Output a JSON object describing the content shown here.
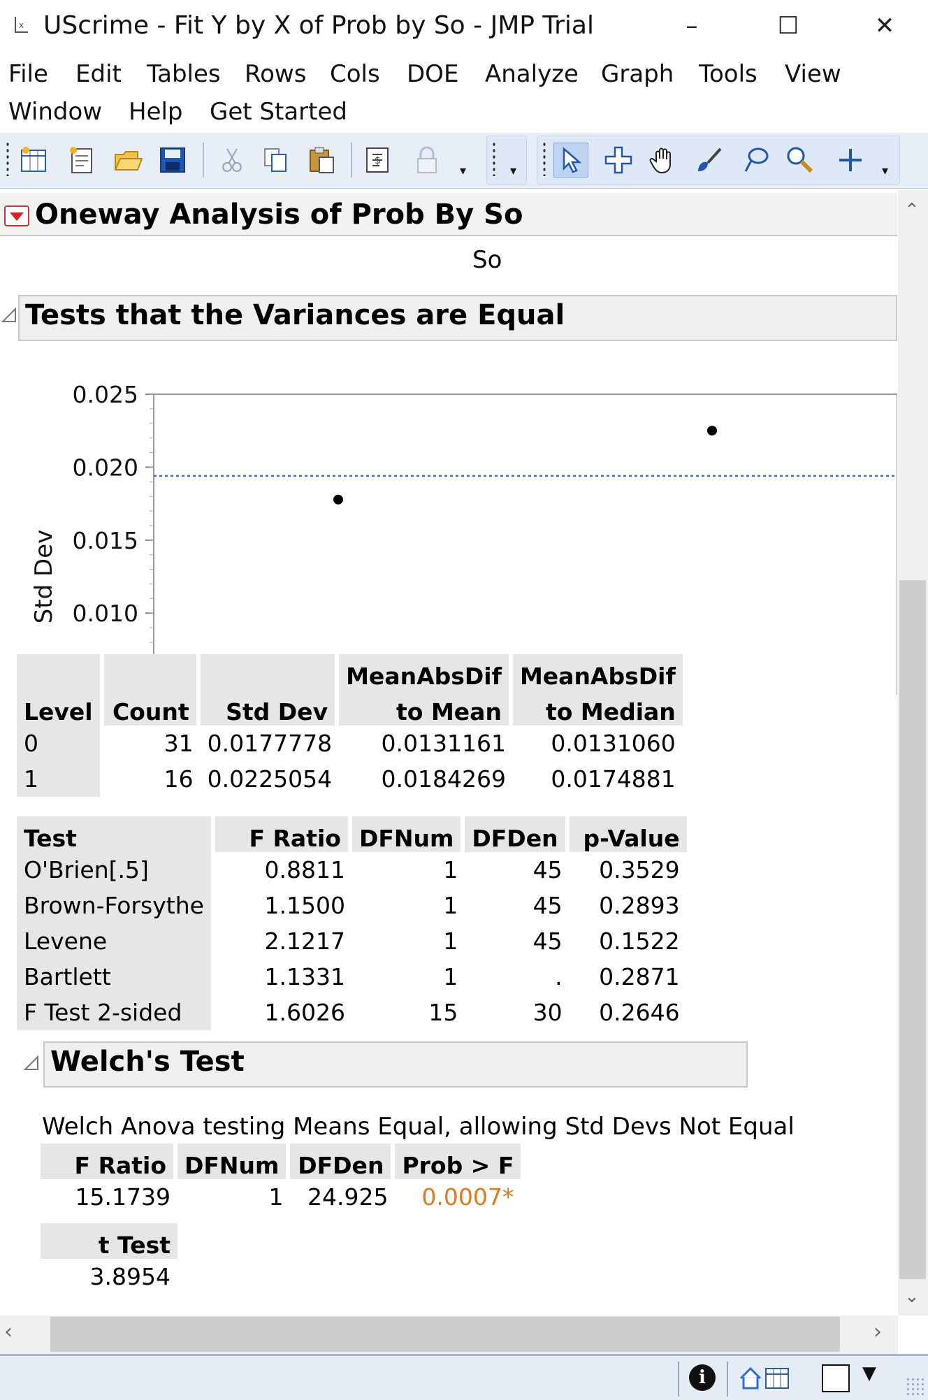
{
  "window": {
    "title": "UScrime - Fit Y by X of Prob by So - JMP Trial",
    "minimize": "–",
    "maximize": "☐",
    "close": "✕"
  },
  "menu": {
    "row1": [
      "File",
      "Edit",
      "Tables",
      "Rows",
      "Cols",
      "DOE",
      "Analyze",
      "Graph",
      "Tools",
      "View"
    ],
    "row2": [
      "Window",
      "Help",
      "Get Started"
    ]
  },
  "report": {
    "title": "Oneway Analysis of Prob By So",
    "top_label": "So",
    "variances_section": "Tests that the Variances are Equal",
    "welch_section": "Welch's Test",
    "welch_caption": "Welch Anova testing Means Equal, allowing Std Devs Not Equal"
  },
  "chart_data": {
    "type": "scatter",
    "ylabel": "Std Dev",
    "xlabel": "So",
    "ylim": [
      0,
      0.025
    ],
    "yticks": [
      "0.025",
      "0.020",
      "0.015",
      "0.010",
      "0.005",
      "0"
    ],
    "xticks": [
      "0",
      "1"
    ],
    "points": [
      {
        "x": 0,
        "y": 0.0177778
      },
      {
        "x": 1,
        "y": 0.0225054
      }
    ],
    "reference_line": {
      "y": 0.0194,
      "style": "dotted",
      "color": "#3a6fd8"
    },
    "grid": false
  },
  "levels_table": {
    "headers": [
      [
        "",
        "Level"
      ],
      [
        "",
        "Count"
      ],
      [
        "",
        "Std Dev"
      ],
      [
        "MeanAbsDif",
        "to Mean"
      ],
      [
        "MeanAbsDif",
        "to Median"
      ]
    ],
    "rows": [
      [
        "0",
        "31",
        "0.0177778",
        "0.0131161",
        "0.0131060"
      ],
      [
        "1",
        "16",
        "0.0225054",
        "0.0184269",
        "0.0174881"
      ]
    ]
  },
  "tests_table": {
    "headers": [
      "Test",
      "F Ratio",
      "DFNum",
      "DFDen",
      "p-Value"
    ],
    "rows": [
      [
        "O'Brien[.5]",
        "0.8811",
        "1",
        "45",
        "0.3529"
      ],
      [
        "Brown-Forsythe",
        "1.1500",
        "1",
        "45",
        "0.2893"
      ],
      [
        "Levene",
        "2.1217",
        "1",
        "45",
        "0.1522"
      ],
      [
        "Bartlett",
        "1.1331",
        "1",
        ".",
        "0.2871"
      ],
      [
        "F Test 2-sided",
        "1.6026",
        "15",
        "30",
        "0.2646"
      ]
    ]
  },
  "welch_table": {
    "headers": [
      "F Ratio",
      "DFNum",
      "DFDen",
      "Prob > F"
    ],
    "row": [
      "15.1739",
      "1",
      "24.925",
      "0.0007*"
    ],
    "significant_color": "#e07a1c",
    "t_header": "t Test",
    "t_value": "3.8954"
  }
}
